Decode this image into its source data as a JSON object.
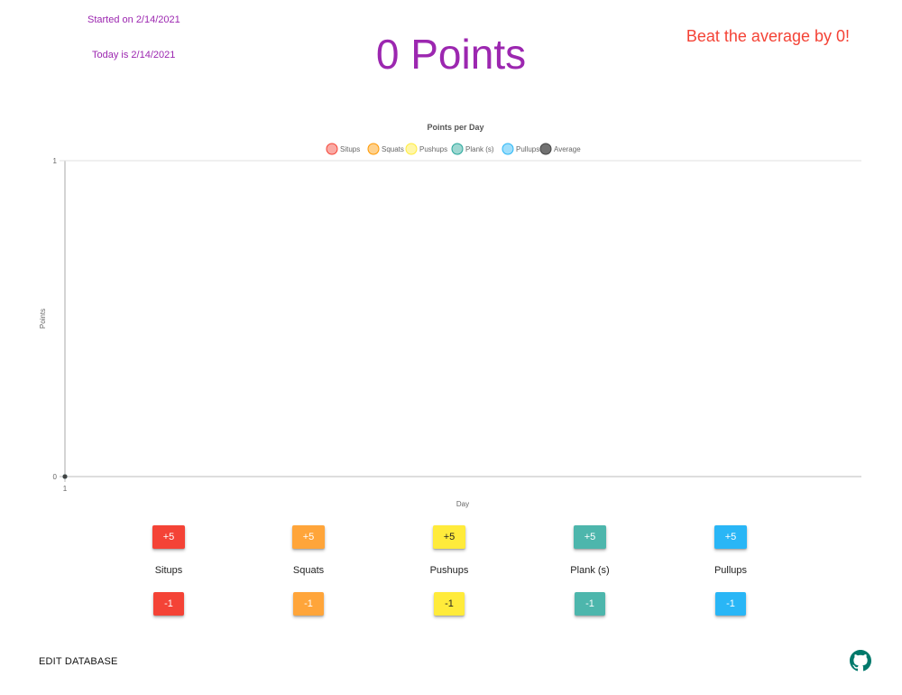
{
  "header": {
    "started": "Started on 2/14/2021",
    "today": "Today is 2/14/2021",
    "points": "0 Points",
    "beat": "Beat the average by 0!"
  },
  "chart_data": {
    "type": "line",
    "title": "Points per Day",
    "xlabel": "Day",
    "ylabel": "Points",
    "x": [
      1
    ],
    "ylim": [
      0,
      1
    ],
    "yticks": [
      "0",
      "1"
    ],
    "xticks": [
      "1"
    ],
    "legend_position": "top",
    "series": [
      {
        "name": "Situps",
        "values": [
          0
        ],
        "color": "#f44336"
      },
      {
        "name": "Squats",
        "values": [
          0
        ],
        "color": "#ff9800"
      },
      {
        "name": "Pushups",
        "values": [
          0
        ],
        "color": "#ffeb3b"
      },
      {
        "name": "Plank (s)",
        "values": [
          0
        ],
        "color": "#26a69a"
      },
      {
        "name": "Pullups",
        "values": [
          0
        ],
        "color": "#29b6f6"
      },
      {
        "name": "Average",
        "values": [
          0
        ],
        "color": "#424242"
      }
    ]
  },
  "exercises": [
    {
      "name": "Situps",
      "plus": "+5",
      "minus": "-1",
      "color": "#f44336",
      "text_color": "#ffffff"
    },
    {
      "name": "Squats",
      "plus": "+5",
      "minus": "-1",
      "color": "#ffa53a",
      "text_color": "#ffffff"
    },
    {
      "name": "Pushups",
      "plus": "+5",
      "minus": "-1",
      "color": "#ffeb3b",
      "text_color": "#222222"
    },
    {
      "name": "Plank (s)",
      "plus": "+5",
      "minus": "-1",
      "color": "#4db6ac",
      "text_color": "#ffffff"
    },
    {
      "name": "Pullups",
      "plus": "+5",
      "minus": "-1",
      "color": "#29b6f6",
      "text_color": "#ffffff"
    }
  ],
  "footer": {
    "edit_db": "EDIT DATABASE",
    "github_icon": "github-icon"
  }
}
